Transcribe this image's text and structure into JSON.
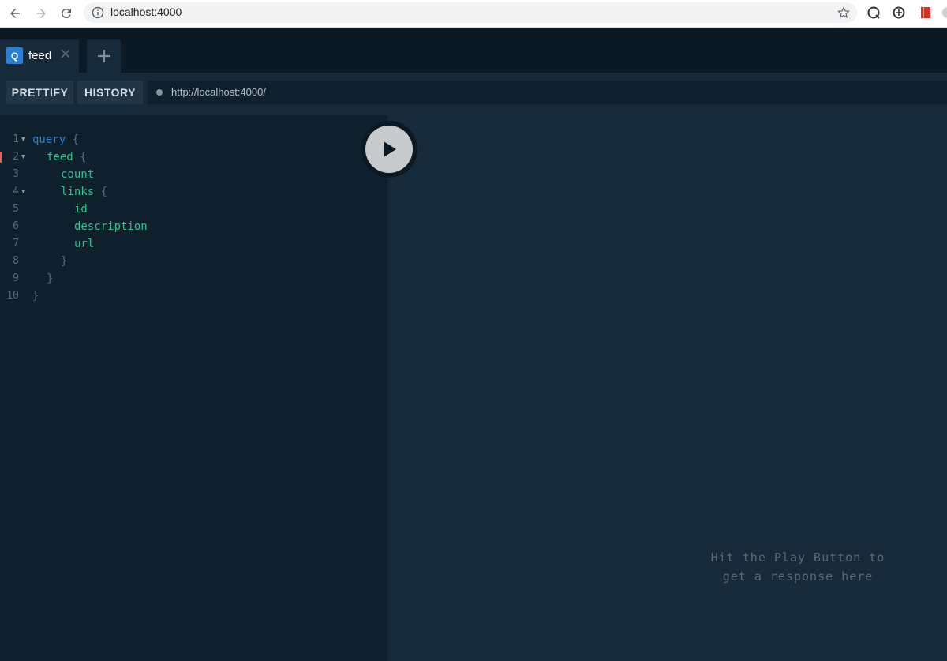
{
  "browser": {
    "url": "localhost:4000"
  },
  "tabs": [
    {
      "badge": "Q",
      "label": "feed"
    }
  ],
  "toolbar": {
    "prettify_label": "PRETTIFY",
    "history_label": "HISTORY",
    "endpoint_url": "http://localhost:4000/"
  },
  "editor": {
    "lines": [
      {
        "n": "1",
        "text": "query {"
      },
      {
        "n": "2",
        "text": "feed {"
      },
      {
        "n": "3",
        "text": "count"
      },
      {
        "n": "4",
        "text": "links {"
      },
      {
        "n": "5",
        "text": "id"
      },
      {
        "n": "6",
        "text": "description"
      },
      {
        "n": "7",
        "text": "url"
      },
      {
        "n": "8",
        "text": "}"
      },
      {
        "n": "9",
        "text": "}"
      },
      {
        "n": "10",
        "text": "}"
      }
    ]
  },
  "result": {
    "hint_line1": "Hit the Play Button to",
    "hint_line2": "get a response here"
  },
  "colors": {
    "keyword": "#2a7ed3",
    "field": "#2dc48d",
    "background": "#0f202d",
    "panel": "#172a3a"
  }
}
